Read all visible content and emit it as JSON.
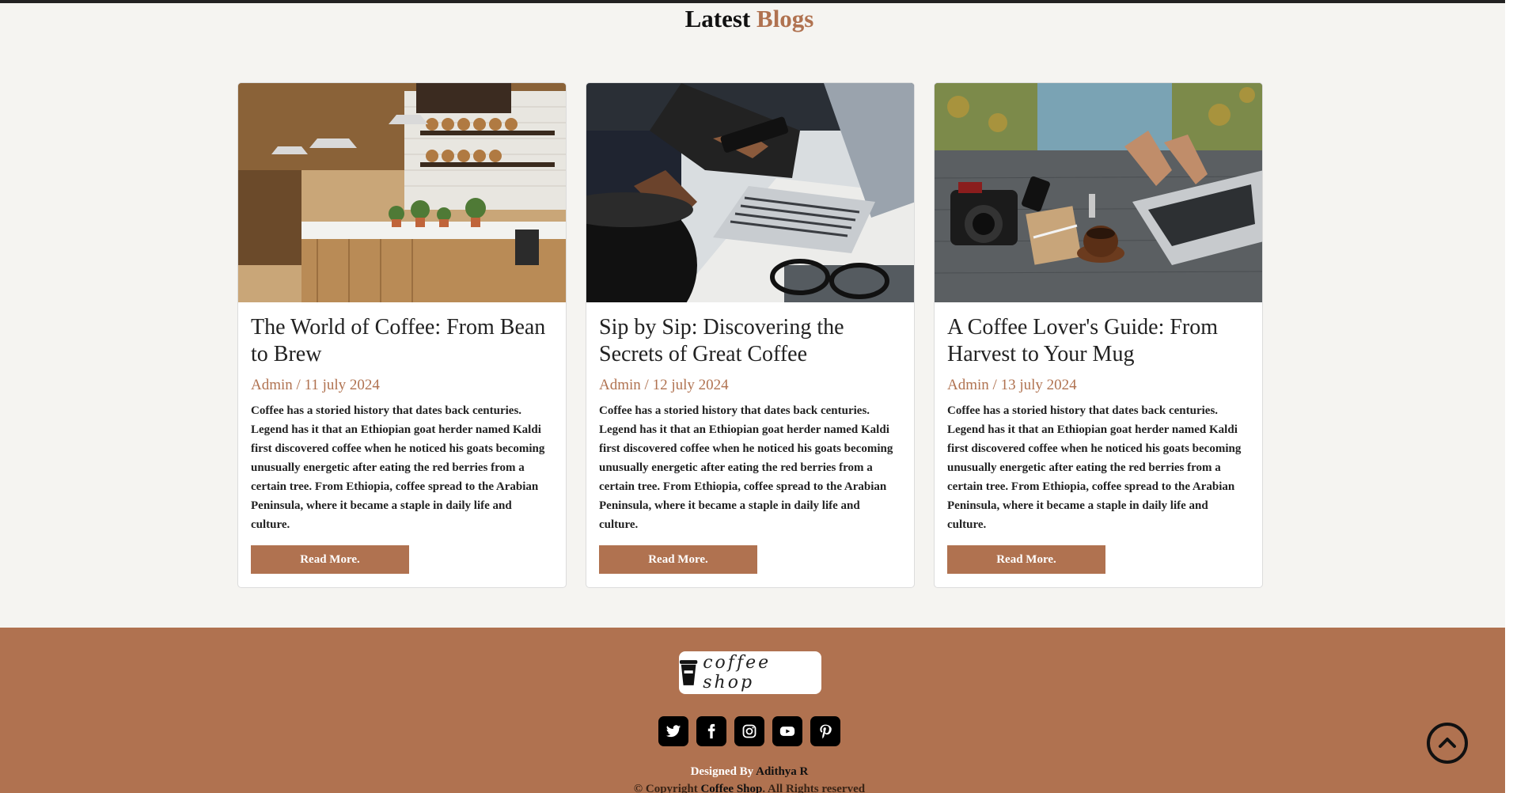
{
  "header": {
    "title_main": "Latest",
    "title_accent": "Blogs"
  },
  "colors": {
    "accent": "#b07250",
    "dark": "#111111",
    "card_bg": "#ffffff"
  },
  "cards": [
    {
      "image": "cafe-interior-photo",
      "title": "The World of Coffee: From Bean to Brew",
      "author": "Admin",
      "date": "11 july 2024",
      "text": "Coffee has a storied history that dates back centuries. Legend has it that an Ethiopian goat herder named Kaldi first discovered coffee when he noticed his goats becoming unusually energetic after eating the red berries from a certain tree. From Ethiopia, coffee spread to the Arabian Peninsula, where it became a staple in daily life and culture.",
      "button": "Read More."
    },
    {
      "image": "phone-laptop-photo",
      "title": "Sip by Sip: Discovering the Secrets of Great Coffee",
      "author": "Admin",
      "date": "12 july 2024",
      "text": "Coffee has a storied history that dates back centuries. Legend has it that an Ethiopian goat herder named Kaldi first discovered coffee when he noticed his goats becoming unusually energetic after eating the red berries from a certain tree. From Ethiopia, coffee spread to the Arabian Peninsula, where it became a staple in daily life and culture.",
      "button": "Read More."
    },
    {
      "image": "desk-camera-laptop-photo",
      "title": "A Coffee Lover's Guide: From Harvest to Your Mug",
      "author": "Admin",
      "date": "13 july 2024",
      "text": "Coffee has a storied history that dates back centuries. Legend has it that an Ethiopian goat herder named Kaldi first discovered coffee when he noticed his goats becoming unusually energetic after eating the red berries from a certain tree. From Ethiopia, coffee spread to the Arabian Peninsula, where it became a staple in daily life and culture.",
      "button": "Read More."
    }
  ],
  "footer": {
    "logo_text": "coffee shop",
    "socials": [
      "twitter-icon",
      "facebook-icon",
      "instagram-icon",
      "youtube-icon",
      "pinterest-icon"
    ],
    "designed_prefix": "Designed By",
    "designer": "Adithya R",
    "copyright_prefix": "© Copyright",
    "copyright_brand": "Coffee Shop",
    "copyright_suffix": ". All Rights reserved"
  },
  "scroll_top_icon": "chevron-up-circle-icon"
}
